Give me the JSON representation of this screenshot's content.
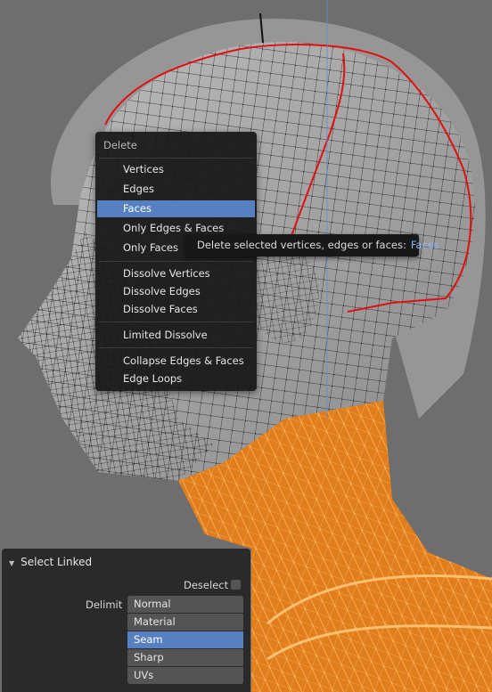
{
  "delete_menu": {
    "title": "Delete",
    "items": [
      {
        "label": "Vertices"
      },
      {
        "label": "Edges"
      },
      {
        "label": "Faces",
        "active": true
      },
      {
        "label": "Only Edges & Faces"
      },
      {
        "label": "Only Faces"
      },
      {
        "label": "Dissolve Vertices"
      },
      {
        "label": "Dissolve Edges"
      },
      {
        "label": "Dissolve Faces"
      },
      {
        "label": "Limited Dissolve"
      },
      {
        "label": "Collapse Edges & Faces"
      },
      {
        "label": "Edge Loops"
      }
    ]
  },
  "tooltip": {
    "text": "Delete selected vertices, edges or faces:",
    "value": "Faces"
  },
  "select_linked_panel": {
    "title": "Select Linked",
    "deselect_label": "Deselect",
    "deselect_checked": false,
    "delimit_label": "Delimit",
    "delimit_options": [
      "Normal",
      "Material",
      "Seam",
      "Sharp",
      "UVs"
    ],
    "delimit_selected": "Seam"
  },
  "colors": {
    "selection_orange": "#ff9426",
    "seam_red": "#e01010",
    "accent_blue": "#5680c2"
  }
}
